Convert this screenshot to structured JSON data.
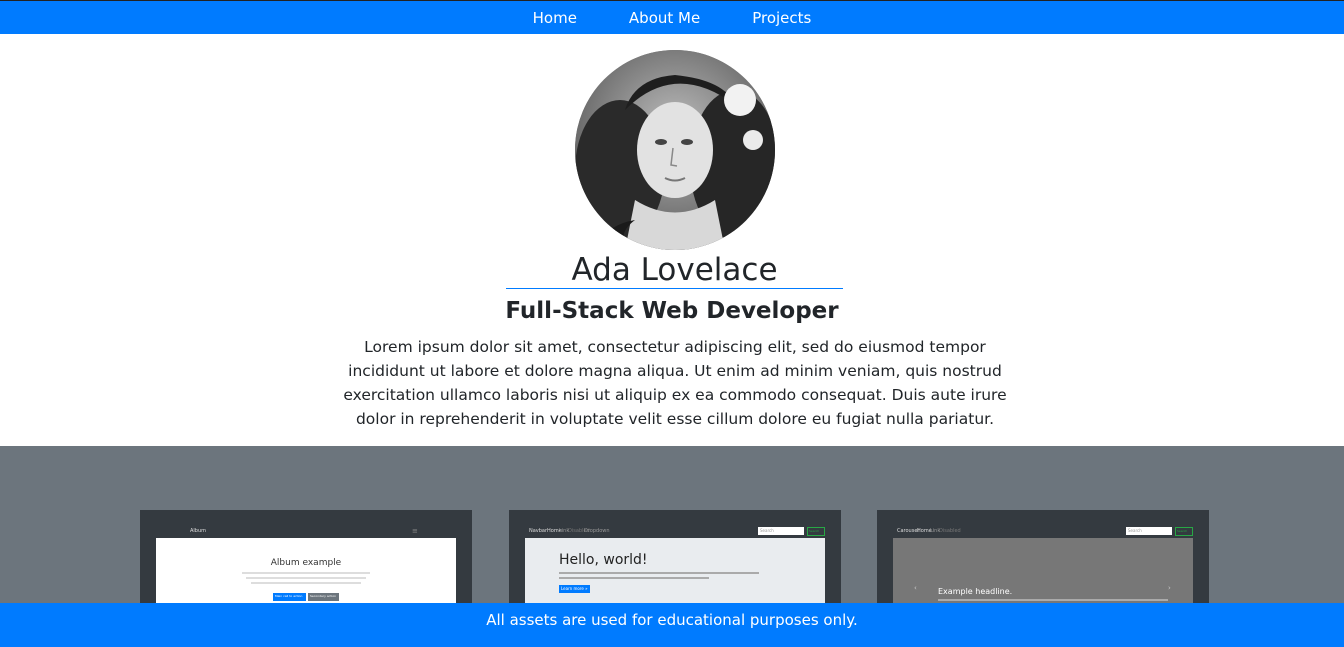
{
  "nav": {
    "items": [
      {
        "label": "Home"
      },
      {
        "label": "About Me"
      },
      {
        "label": "Projects"
      }
    ]
  },
  "profile": {
    "name": "Ada Lovelace",
    "title": "Full-Stack Web Developer",
    "bio": "Lorem ipsum dolor sit amet, consectetur adipiscing elit, sed do eiusmod tempor incididunt ut labore et dolore magna aliqua. Ut enim ad minim veniam, quis nostrud exercitation ullamco laboris nisi ut aliquip ex ea commodo consequat. Duis aute irure dolor in reprehenderit in voluptate velit esse cillum dolore eu fugiat nulla pariatur."
  },
  "projects": [
    {
      "brand": "Album",
      "heading": "Album example",
      "btn1": "Main call to action",
      "btn2": "Secondary action"
    },
    {
      "brand": "Navbar",
      "links": [
        "Home",
        "Link",
        "Disabled",
        "Dropdown"
      ],
      "search": "Search",
      "search_btn": "Search",
      "heading": "Hello, world!",
      "btn1": "Learn more »"
    },
    {
      "brand": "Carousel",
      "links": [
        "Home",
        "Link",
        "Disabled"
      ],
      "search": "Search",
      "search_btn": "Search",
      "heading": "Example headline."
    }
  ],
  "footer": {
    "text": "All assets are used for educational purposes only."
  },
  "colors": {
    "primary": "#007bff",
    "projects_bg": "#6c757d",
    "dark": "#343a40"
  }
}
